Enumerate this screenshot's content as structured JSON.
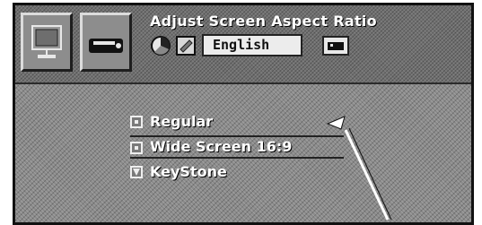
{
  "osd": {
    "title": "Adjust Screen Aspect Ratio",
    "language_value": "English",
    "icons": {
      "picture_tile": "monitor-icon",
      "screen_tile": "projector-icon",
      "color": "color-wheel-icon",
      "note": "note-icon",
      "remote": "remote-icon"
    }
  },
  "menu": {
    "items": [
      {
        "label": "Regular",
        "selected": false
      },
      {
        "label": "Wide Screen 16:9",
        "selected": true
      },
      {
        "label": "KeyStone",
        "selected": false
      }
    ]
  }
}
